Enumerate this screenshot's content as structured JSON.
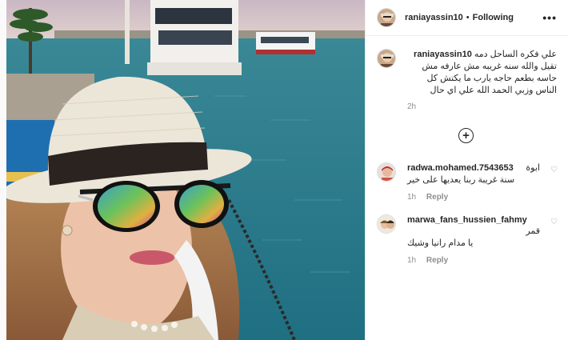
{
  "post": {
    "username": "raniayassin10",
    "separator": "•",
    "follow_label": "Following",
    "more_label": "•••",
    "caption": {
      "username": "raniayassin10",
      "text": "علي فكره الساحل دمه تقيل والله سنه غريبه مش عارفه مش حاسه بطعم حاجه يارب ما يكتش كل الناس وزبي الحمد الله علي اي حال",
      "time": "2h"
    },
    "load_more": "+",
    "comments": [
      {
        "username": "radwa.mohamed.7543653",
        "text": "ابوة",
        "text2": "سنة غريبة ربنا يعديها على خير",
        "time": "1h",
        "reply_label": "Reply",
        "like": "♡"
      },
      {
        "username": "marwa_fans_hussien_fahmy",
        "text": "قمر",
        "text2": "يا مدام رانيا وشيك",
        "time": "1h",
        "reply_label": "Reply",
        "like": "♡"
      }
    ]
  },
  "colors": {
    "sea": "#2a8a9a",
    "hat": "#ece6d8",
    "hat_band": "#2b2320",
    "text_secondary": "#8e8e8e"
  }
}
